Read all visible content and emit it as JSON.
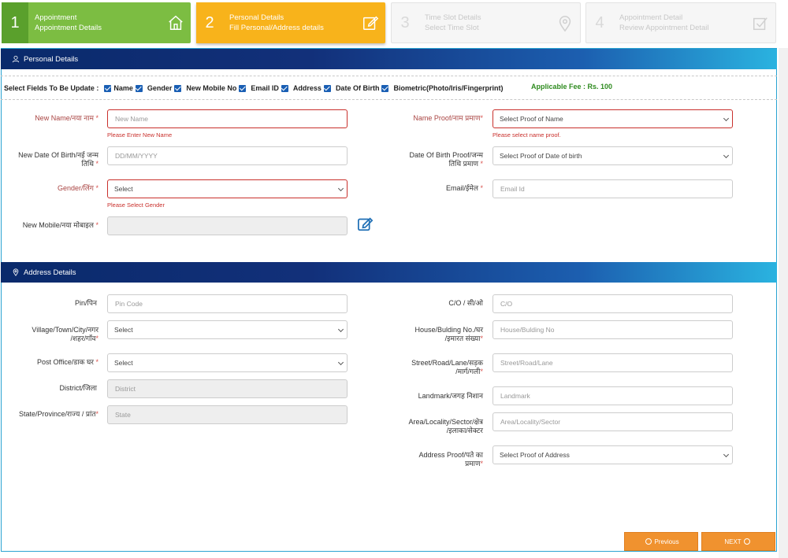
{
  "steps": [
    {
      "num": "1",
      "title": "Appointment",
      "subtitle": "Appointment Details",
      "icon": "home-icon"
    },
    {
      "num": "2",
      "title": "Personal Details",
      "subtitle": "Fill Personal/Address details",
      "icon": "edit-icon"
    },
    {
      "num": "3",
      "title": "Time Slot Details",
      "subtitle": "Select Time Slot",
      "icon": "location-pin-icon"
    },
    {
      "num": "4",
      "title": "Appointment Detail",
      "subtitle": "Review Appointment Detail",
      "icon": "checkbox-icon"
    }
  ],
  "personal": {
    "section_title": "Personal Details",
    "select_fields_label": "Select Fields To Be Update :",
    "update_fields": [
      "Name",
      "Gender",
      "New Mobile No",
      "Email ID",
      "Address",
      "Date Of Birth",
      "Biometric(Photo/Iris/Fingerprint)"
    ],
    "fee": "Applicable Fee : Rs. 100",
    "new_name": {
      "label": "New Name/नया नाम",
      "placeholder": "New Name",
      "error": "Please Enter New Name"
    },
    "name_proof": {
      "label": "Name Proof/नाम प्रमाण",
      "value": "Select Proof of Name",
      "error": "Please select name proof."
    },
    "dob": {
      "label_1": "New Date Of Birth/नई जन्म",
      "label_2": "तिथि",
      "placeholder": "DD/MM/YYYY"
    },
    "dob_proof": {
      "label_1": "Date Of Birth Proof/जन्म",
      "label_2": "तिथि प्रमाण",
      "value": "Select Proof of Date of birth"
    },
    "gender": {
      "label": "Gender/लिंग",
      "value": "Select",
      "error": "Please Select Gender"
    },
    "email": {
      "label": "Email/ईमेल",
      "placeholder": "Email Id"
    },
    "mobile": {
      "label": "New Mobile/नया मोबाइल",
      "value": ""
    }
  },
  "address": {
    "section_title": "Address Details",
    "pin": {
      "label": "Pin/पिन",
      "placeholder": "Pin Code"
    },
    "village": {
      "label_1": "Village/Town/City/नगर",
      "label_2": "/शहर/गाँव",
      "value": "Select"
    },
    "post_office": {
      "label": "Post Office/डाक घर",
      "value": "Select"
    },
    "district": {
      "label": "District/जिला",
      "placeholder": "District"
    },
    "state": {
      "label": "State/Province/राज्य / प्रांत",
      "placeholder": "State"
    },
    "co": {
      "label": "C/O / सी/ओ",
      "placeholder": "C/O"
    },
    "house": {
      "label_1": "House/Bulding No./घर",
      "label_2": "/इमारत संख्या",
      "placeholder": "House/Bulding No"
    },
    "street": {
      "label_1": "Street/Road/Lane/सड़क",
      "label_2": "/मार्ग/गली",
      "placeholder": "Street/Road/Lane"
    },
    "landmark": {
      "label": "Landmark/जगह निशान",
      "placeholder": "Landmark"
    },
    "area": {
      "label_1": "Area/Locality/Sector/क्षेत्र",
      "label_2": "/इलाका/सेक्टर",
      "placeholder": "Area/Locality/Sector"
    },
    "address_proof": {
      "label_1": "Address Proof/पते का",
      "label_2": "प्रमाण",
      "value": "Select Proof of Address"
    }
  },
  "footer": {
    "previous_label": "Previous",
    "next_label": "NEXT"
  },
  "colors": {
    "step_done": "#7cbd42",
    "step_active": "#f8b31b",
    "section_bar": "#0a2a6b",
    "button": "#f0922f",
    "fee": "#2e8b1f",
    "error": "#c9302c"
  }
}
